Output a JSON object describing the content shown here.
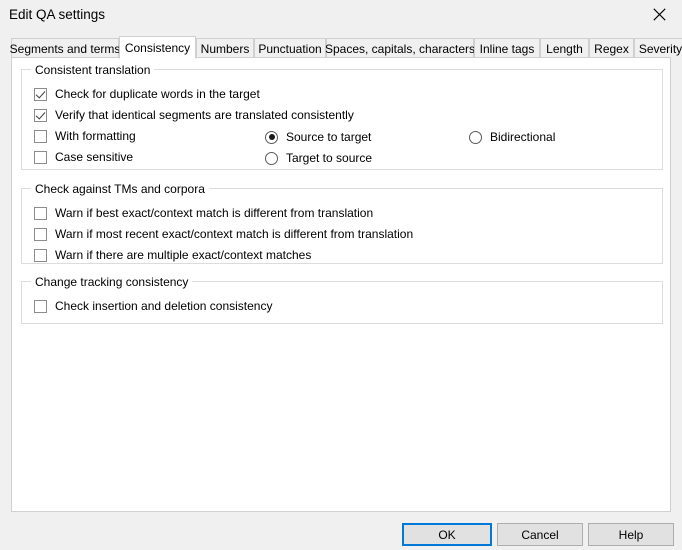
{
  "window": {
    "title": "Edit QA settings",
    "close_icon": "close-icon"
  },
  "tabs": [
    {
      "label": "Segments and terms",
      "selected": false
    },
    {
      "label": "Consistency",
      "selected": true
    },
    {
      "label": "Numbers",
      "selected": false
    },
    {
      "label": "Punctuation",
      "selected": false
    },
    {
      "label": "Spaces, capitals, characters",
      "selected": false
    },
    {
      "label": "Inline tags",
      "selected": false
    },
    {
      "label": "Length",
      "selected": false
    },
    {
      "label": "Regex",
      "selected": false
    },
    {
      "label": "Severity",
      "selected": false
    }
  ],
  "groups": {
    "consistent_translation": {
      "title": "Consistent translation",
      "checkboxes": [
        {
          "label": "Check for duplicate words in the target",
          "checked": true
        },
        {
          "label": "Verify that identical segments are translated consistently",
          "checked": true
        },
        {
          "label": "With formatting",
          "checked": false
        },
        {
          "label": "Case sensitive",
          "checked": false
        }
      ],
      "radios": [
        {
          "label": "Source to target",
          "selected": true
        },
        {
          "label": "Target to source",
          "selected": false
        },
        {
          "label": "Bidirectional",
          "selected": false
        }
      ]
    },
    "check_against_tms": {
      "title": "Check against TMs and corpora",
      "checkboxes": [
        {
          "label": "Warn if best exact/context match is different from translation",
          "checked": false
        },
        {
          "label": "Warn if most recent exact/context match is different from translation",
          "checked": false
        },
        {
          "label": "Warn if there are multiple exact/context matches",
          "checked": false
        }
      ]
    },
    "change_tracking": {
      "title": "Change tracking consistency",
      "checkboxes": [
        {
          "label": "Check insertion and deletion consistency",
          "checked": false
        }
      ]
    }
  },
  "footer": {
    "ok_label": "OK",
    "cancel_label": "Cancel",
    "help_label": "Help"
  },
  "colors": {
    "dialog_background": "#f0f0f0",
    "panel_background": "#ffffff",
    "accent_focus": "#0078d7",
    "border": "#d0d0d0",
    "group_border": "#dcdcdc"
  }
}
